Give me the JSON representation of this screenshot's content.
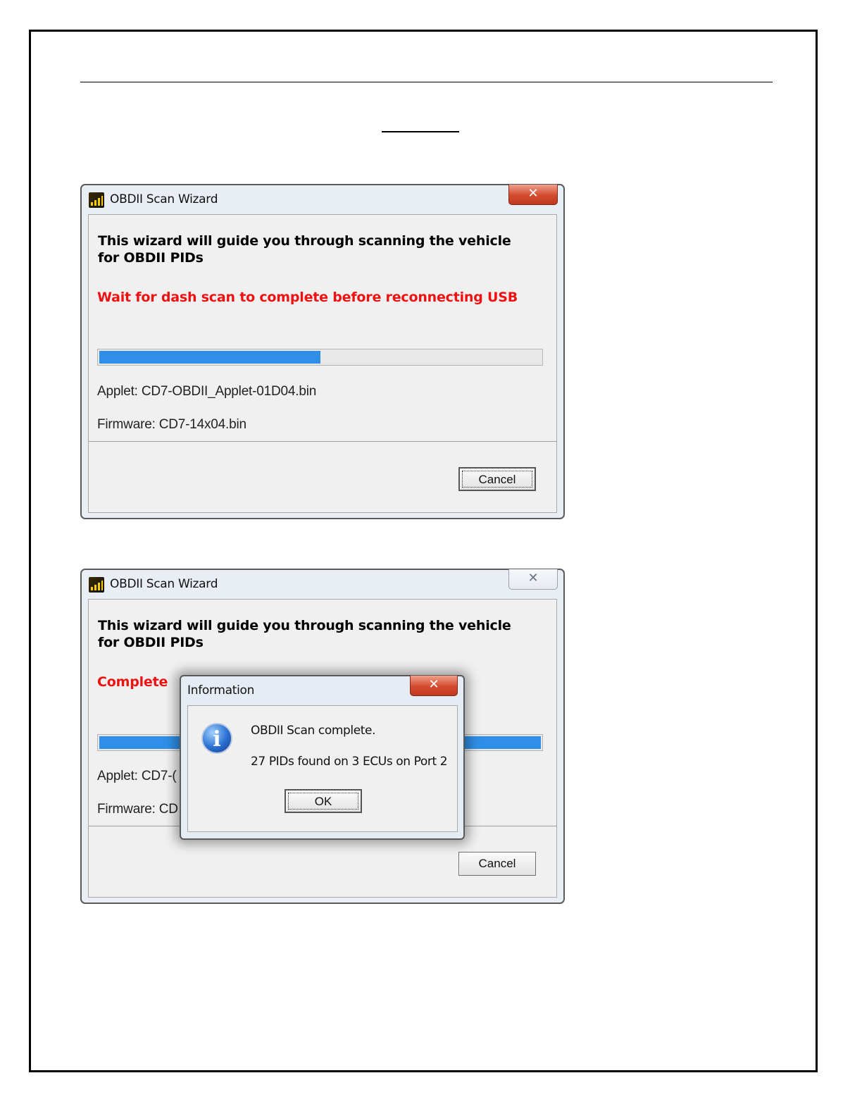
{
  "document": {},
  "dialog1": {
    "title": "OBDII Scan Wizard",
    "close_glyph": "✕",
    "heading": "This wizard will guide you through scanning the vehicle for OBDII PIDs",
    "status": "Wait for dash scan to complete before reconnecting USB",
    "status_color": "#ee1111",
    "progress_fraction": 0.5,
    "progress_color": "#2f8fe8",
    "applet": "Applet: CD7-OBDII_Applet-01D04.bin",
    "firmware": "Firmware: CD7-14x04.bin",
    "cancel_label": "Cancel"
  },
  "dialog2": {
    "title": "OBDII Scan Wizard",
    "close_glyph": "✕",
    "heading": "This wizard will guide you through scanning the vehicle for OBDII PIDs",
    "status": "Complete",
    "status_color": "#ee1111",
    "progress_fraction": 1.0,
    "applet_partial": "Applet: CD7-(",
    "firmware_partial": "Firmware: CD",
    "cancel_label": "Cancel"
  },
  "message_box": {
    "title": "Information",
    "close_glyph": "✕",
    "icon": "info-icon",
    "line1": "OBDII Scan complete.",
    "line2": "27 PIDs found on 3 ECUs on Port 2",
    "ok_label": "OK"
  }
}
